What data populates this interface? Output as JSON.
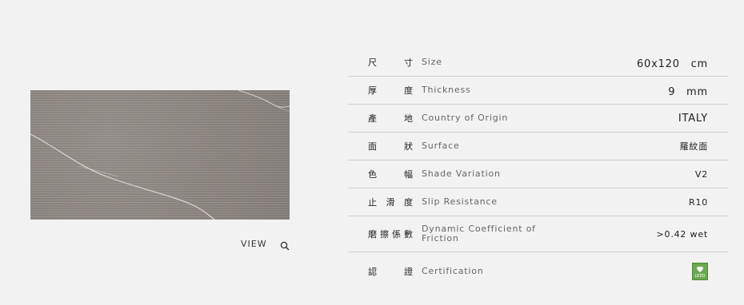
{
  "view": {
    "label": "VIEW",
    "icon": "search-icon"
  },
  "specs": [
    {
      "zh": [
        "尺",
        "寸"
      ],
      "en": "Size",
      "value": "60x120　cm"
    },
    {
      "zh": [
        "厚",
        "度"
      ],
      "en": "Thickness",
      "value": "9　mm"
    },
    {
      "zh": [
        "產",
        "地"
      ],
      "en": "Country of Origin",
      "value": "ITALY"
    },
    {
      "zh": [
        "面",
        "狀"
      ],
      "en": "Surface",
      "value": "羅紋面"
    },
    {
      "zh": [
        "色",
        "幅"
      ],
      "en": "Shade Variation",
      "value": "V2"
    },
    {
      "zh": [
        "止",
        "滑",
        "度"
      ],
      "en": "Slip Resistance",
      "value": "R10"
    },
    {
      "zh": [
        "磨",
        "擦",
        "係",
        "數"
      ],
      "en": "Dynamic Coefficient of Friction",
      "value": ">0.42 wet"
    },
    {
      "zh": [
        "認",
        "證"
      ],
      "en": "Certification",
      "value": "",
      "badge_text": "LEED",
      "badge_icon": "leed-badge-icon"
    }
  ],
  "colors": {
    "background": "#f2f2f2",
    "divider": "#cfcfcf",
    "tile": "#8f8883",
    "leed_green": "#6aa84f"
  }
}
